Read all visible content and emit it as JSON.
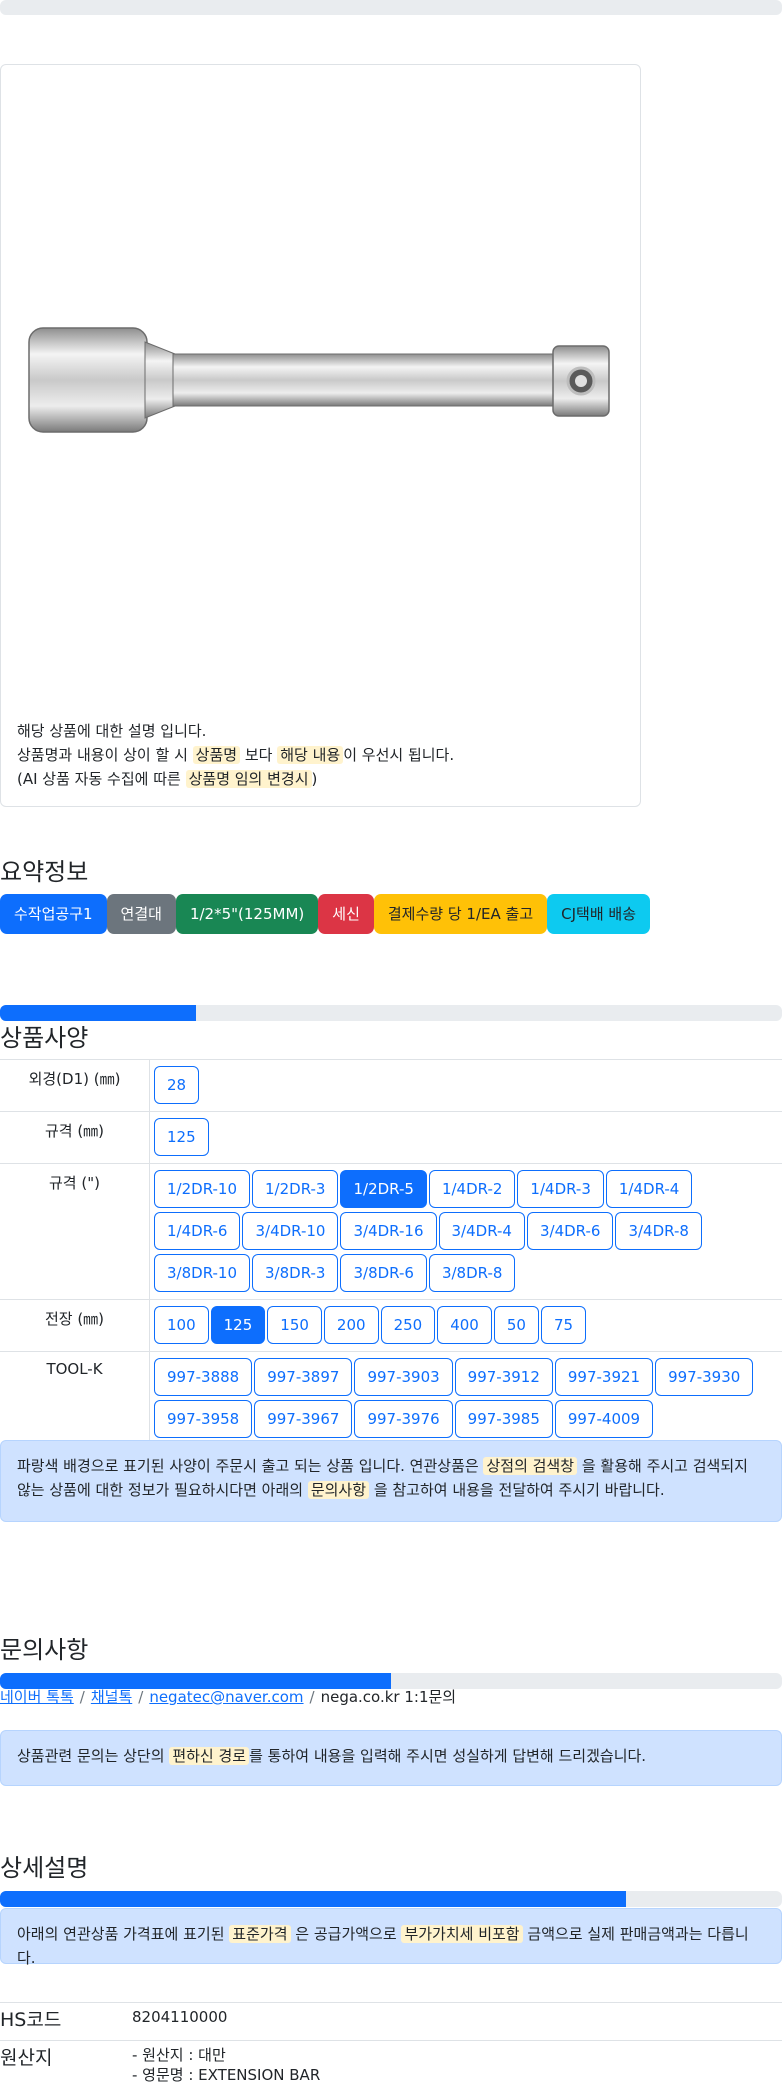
{
  "card": {
    "desc_line1": "해당 상품에 대한 설명 입니다.",
    "desc_line2_a": "상품명과 내용이 상이 할 시",
    "desc_line2_hl1": "상품명",
    "desc_line2_b": "보다",
    "desc_line2_hl2": "해당 내용",
    "desc_line2_c": "이 우선시 됩니다.",
    "desc_line3_a": "(AI 상품 자동 수집에 따른",
    "desc_line3_hl": "상품명 임의 변경시",
    "desc_line3_b": ")"
  },
  "summary": {
    "title": "요약정보",
    "badges": [
      {
        "label": "수작업공구1",
        "color": "#0d6efd"
      },
      {
        "label": "연결대",
        "color": "#6c757d"
      },
      {
        "label": "1/2*5\"(125MM)",
        "color": "#198754"
      },
      {
        "label": "세신",
        "color": "#dc3545"
      },
      {
        "label": "결제수량 당 1/EA 출고",
        "color": "#ffc107",
        "text_color": "#212529"
      },
      {
        "label": "CJ택배 배송",
        "color": "#0dcaf0",
        "text_color": "#212529"
      }
    ]
  },
  "specs": {
    "title": "상품사양",
    "progress_fraction": 0.25,
    "rows": [
      {
        "label": "외경(D1) (㎜)",
        "options": [
          "28"
        ],
        "selected": -1
      },
      {
        "label": "규격 (㎜)",
        "options": [
          "125"
        ],
        "selected": -1
      },
      {
        "label": "규격 (\")",
        "options": [
          "1/2DR-10",
          "1/2DR-3",
          "1/2DR-5",
          "1/4DR-2",
          "1/4DR-3",
          "1/4DR-4",
          "1/4DR-6",
          "3/4DR-10",
          "3/4DR-16",
          "3/4DR-4",
          "3/4DR-6",
          "3/4DR-8",
          "3/8DR-10",
          "3/8DR-3",
          "3/8DR-6",
          "3/8DR-8"
        ],
        "selected": 2
      },
      {
        "label": "전장 (㎜)",
        "options": [
          "100",
          "125",
          "150",
          "200",
          "250",
          "400",
          "50",
          "75"
        ],
        "selected": 1
      },
      {
        "label": "TOOL-K",
        "options": [
          "997-3888",
          "997-3897",
          "997-3903",
          "997-3912",
          "997-3921",
          "997-3930",
          "997-3958",
          "997-3967",
          "997-3976",
          "997-3985",
          "997-4009"
        ],
        "selected": -1
      }
    ],
    "notice_a": "파랑색 배경으로 표기된 사양이 주문시 출고 되는 상품 입니다. 연관상품은",
    "notice_hl1": "상점의 검색창",
    "notice_b": "을 활용해 주시고 검색되지 않는 상품에 대한 정보가 필요하시다면 아래의",
    "notice_hl2": "문의사항",
    "notice_c": "을 참고하여 내용을 전달하여 주시기 바랍니다."
  },
  "inquiry": {
    "title": "문의사항",
    "progress_fraction": 0.5,
    "links": [
      "네이버 톡톡",
      "채널톡",
      "negatec@naver.com"
    ],
    "last_text": "nega.co.kr 1:1문의",
    "separator": "/",
    "notice_a": "상품관련 문의는 상단의",
    "notice_hl": "편하신 경로",
    "notice_b": "를 통하여 내용을 입력해 주시면 성실하게 답변해 드리겠습니다."
  },
  "detail": {
    "title": "상세설명",
    "progress_fraction": 0.8,
    "notice_a": "아래의 연관상품 가격표에 표기된",
    "notice_hl1": "표준가격",
    "notice_b": "은 공급가액으로",
    "notice_hl2": "부가가치세 비포함",
    "notice_c": "금액으로 실제 판매금액과는 다릅니다."
  },
  "info": {
    "hs_label": "HS코드",
    "hs_value": "8204110000",
    "origin_label": "원산지",
    "origin_line1": "- 원산지 : 대만",
    "origin_line2": "- 영문명 : EXTENSION BAR"
  },
  "colors": {
    "primary": "#0d6efd",
    "alert_bg": "#cfe2ff",
    "highlight": "#fff3cd"
  }
}
